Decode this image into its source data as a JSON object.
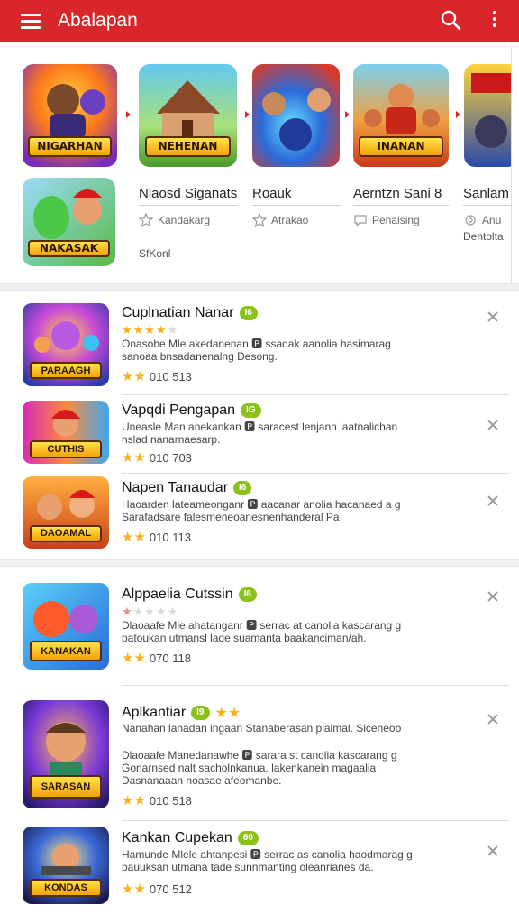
{
  "appbar": {
    "title": "Abalapan",
    "menu_icon": "hamburger-menu-icon",
    "search_icon": "search-icon",
    "more_icon": "more-vertical-icon",
    "color": "#d9262b"
  },
  "featured": {
    "tiles": [
      {
        "banner": "NIGARHAN",
        "icon": "game-art-icon"
      },
      {
        "banner": "NEHENAN",
        "icon": "game-art-icon"
      },
      {
        "banner": "",
        "icon": "game-art-icon"
      },
      {
        "banner": "INANAN",
        "icon": "game-art-icon"
      },
      {
        "banner": "",
        "icon": "game-art-icon"
      },
      {
        "banner": "NAKASAK",
        "icon": "game-art-icon"
      }
    ],
    "items": [
      {
        "name": "Nlaosd Siganats",
        "meta": "Kandakarg"
      },
      {
        "name": "Roauk",
        "meta": "Atrakao"
      },
      {
        "name": "Aerntzn Sani 8",
        "meta": "Penaising"
      },
      {
        "name": "Sanlam",
        "meta": "Anu"
      }
    ],
    "extra_meta": "Dentolta",
    "sub_label": "SfKonl"
  },
  "apps": [
    {
      "name": "Cuplnatian Nanar",
      "badge": "I6",
      "rating": 4,
      "desc": "Onasobe Mle akedanenan 🅿 ssadak aanolia hasimarag sanoaa bnsadanenalng Desong.",
      "count_stars": 2,
      "count": "010 513",
      "banner": "PARAAGH"
    },
    {
      "name": "Vapqdi Pengapan",
      "badge": "IG",
      "rating": 0,
      "desc": "Uneasle Man anekankan 🅿 saracest lenjann laatnalichan nslad nanarnaesarp.",
      "count_stars": 2,
      "count": "010 703",
      "banner": "CUTHIS"
    },
    {
      "name": "Napen Tanaudar",
      "badge": "I6",
      "rating": 0,
      "desc": "Haoarden lateameonganr 🅿 aacanar anolia hacanaed a g Sarafadsare falesmeneoanesnenhanderal Pa",
      "count_stars": 2,
      "count": "010 113",
      "banner": "DAOAMAL"
    },
    {
      "name": "Alppaelia Cutssin",
      "badge": "I6",
      "rating": 1,
      "desc": "Dlaoaafe Mle ahatanganr 🅿 serrac at canolia kascarang g patoukan utmansl lade suamanta baakanciman/ah.",
      "count_stars": 2,
      "count": "070 118",
      "banner": "KANAKAN"
    },
    {
      "name": "Aplkantiar",
      "badge": "I9",
      "rating": 2,
      "extra": "Nanahan lanadan ingaan Stanaberasan plalmal. Siceneoo",
      "desc": "Dlaoaafe Manedanawhe 🅿 sarara st canolia kascarang g Gonarnsed nalt sacholnkanua. lakenkanein magaalia Dasnanaaan noasae afeomanbe.",
      "count_stars": 2,
      "count": "010 518",
      "banner": "SARASAN"
    },
    {
      "name": "Kankan Cupekan",
      "badge": "66",
      "rating": 0,
      "desc": "Hamunde Mlele ahtanpesi 🅿 serrac as canolia haodmarag g pauuksan utmana tade sunnmanting oleanrianes da.",
      "count_stars": 2,
      "count": "070 512",
      "banner": "KONDAS"
    }
  ],
  "close_icon": "close-icon"
}
